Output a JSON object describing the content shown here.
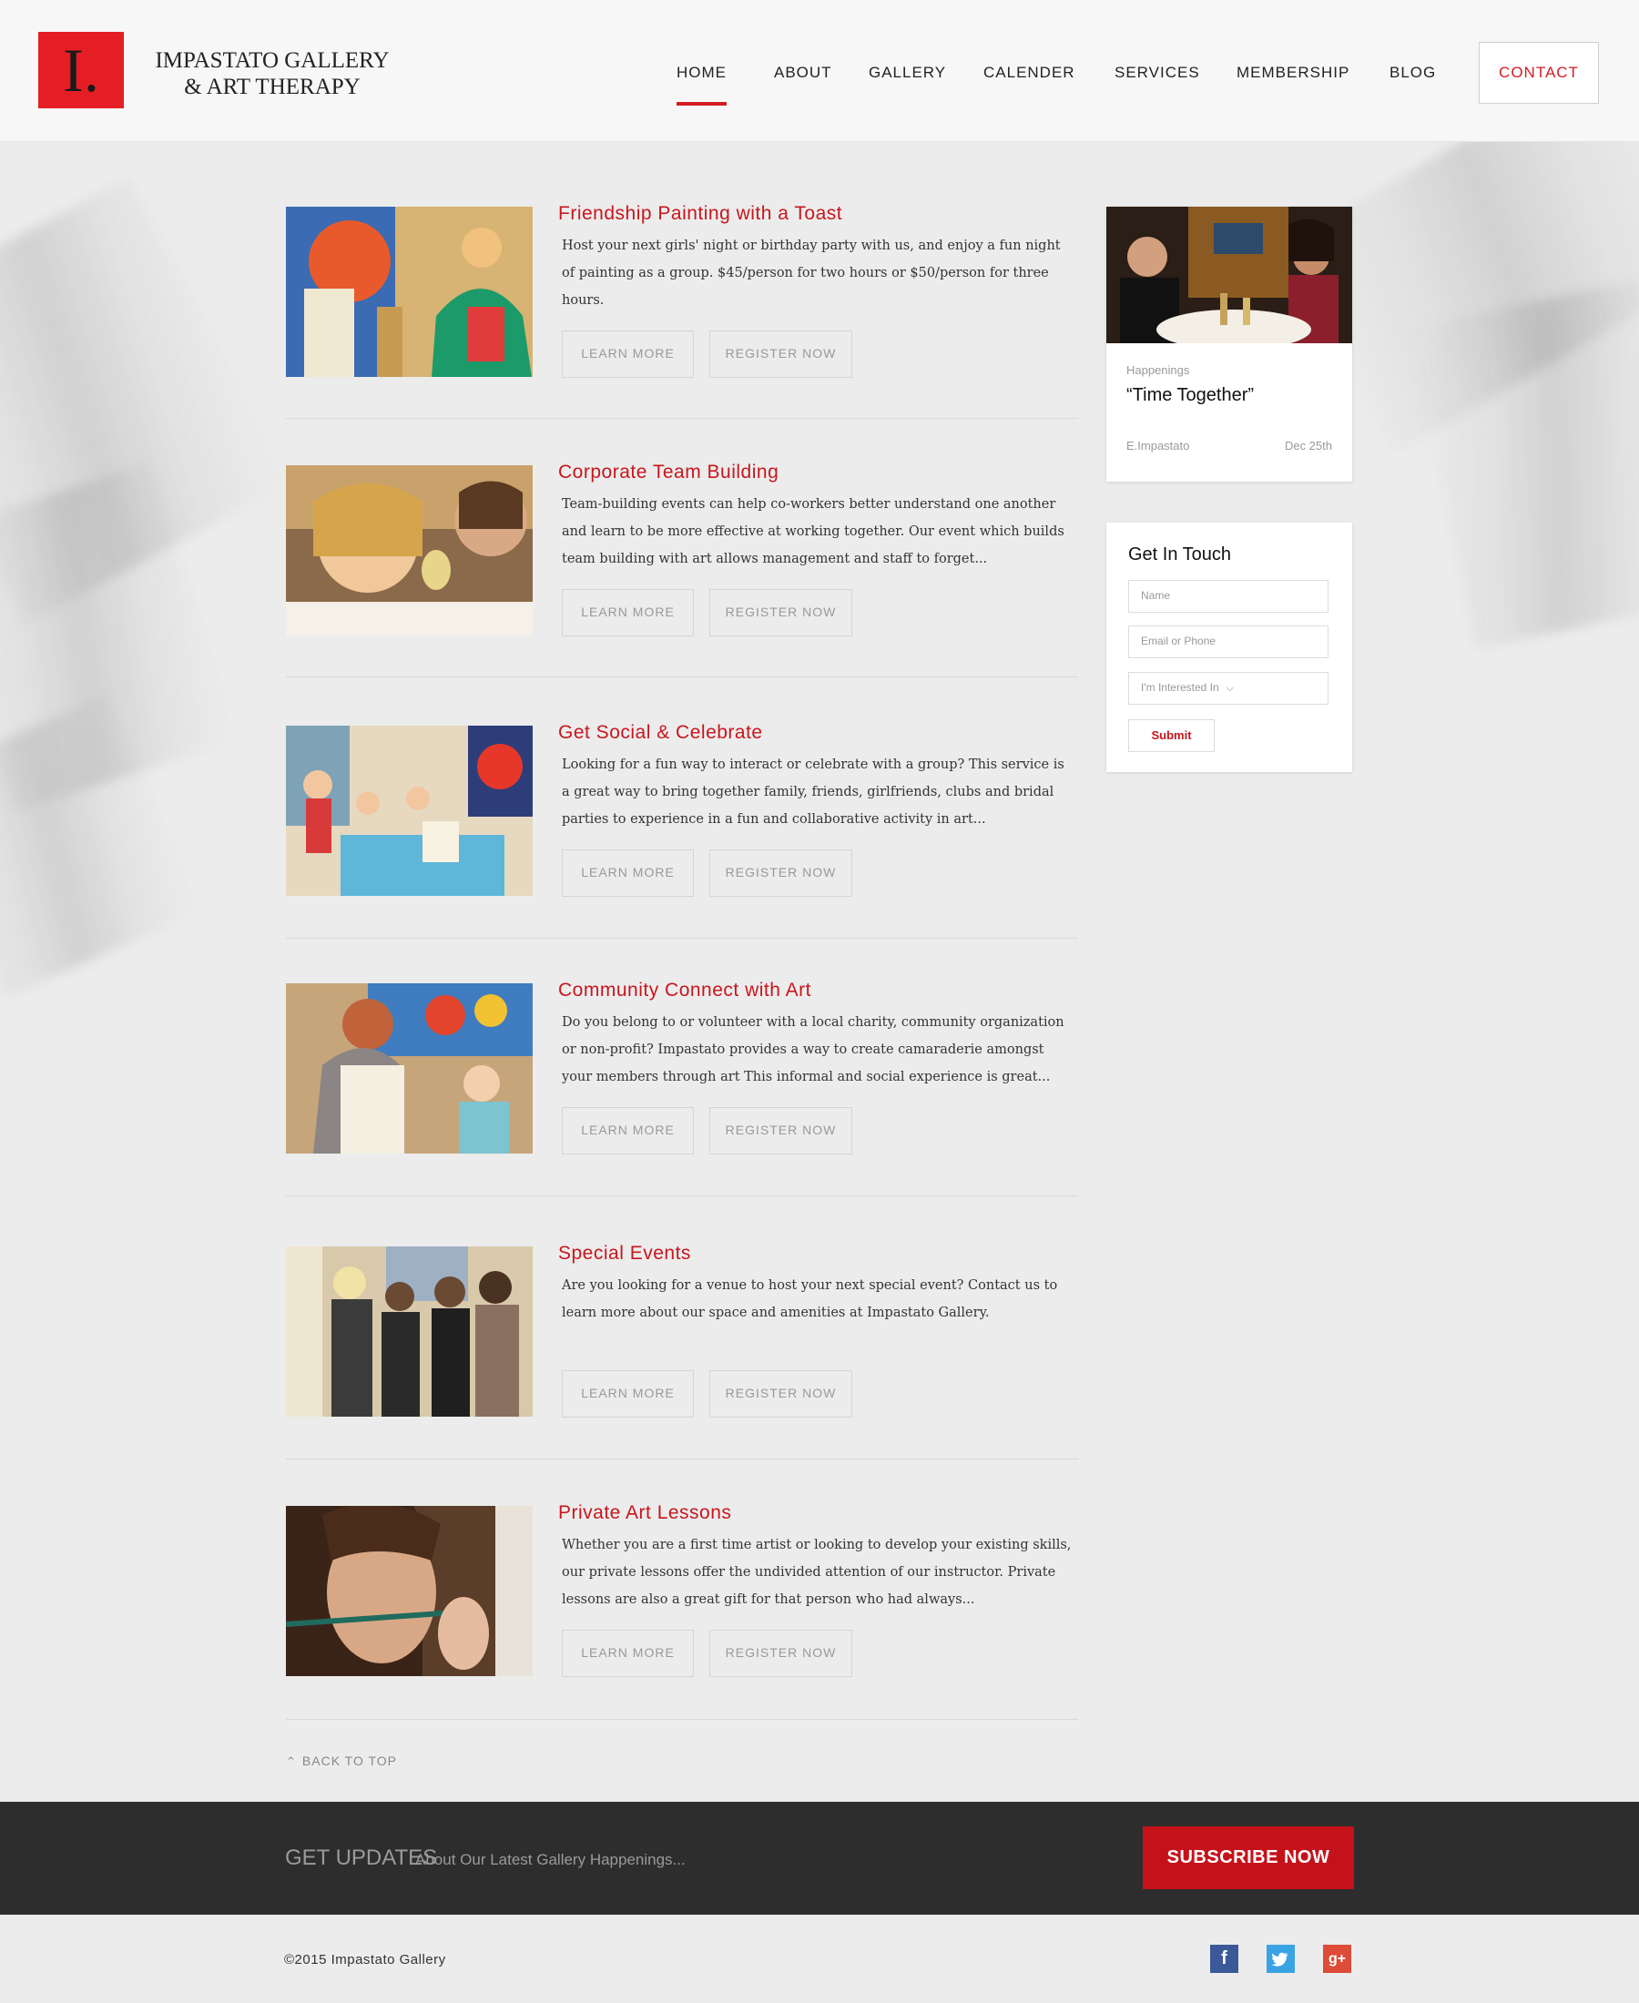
{
  "brand": {
    "logo_letter": "I.",
    "name_line1": "IMPASTATO GALLERY",
    "name_line2": "& ART THERAPY",
    "accent": "#d11d24"
  },
  "nav": {
    "items": [
      "HOME",
      "ABOUT",
      "GALLERY",
      "CALENDER",
      "SERVICES",
      "MEMBERSHIP",
      "BLOG"
    ],
    "active": "HOME",
    "contact": "CONTACT"
  },
  "services": [
    {
      "title": "Friendship Painting with a Toast",
      "desc": "Host your next girls' night or birthday party with us, and enjoy a fun night of painting as a group. $45/person for two hours or $50/person for three hours.",
      "learn": "LEARN MORE",
      "register": "REGISTER NOW"
    },
    {
      "title": "Corporate Team Building",
      "desc": "Team-building events can help co-workers better understand one another and learn to be more effective at working together. Our event which builds team building with art allows management and staff to forget...",
      "learn": "LEARN MORE",
      "register": "REGISTER NOW"
    },
    {
      "title": "Get Social & Celebrate",
      "desc": "Looking for a fun way to interact or celebrate with a group? This service is a great way to bring together family, friends, girlfriends, clubs and bridal parties to experience in a fun and collaborative activity in art...",
      "learn": "LEARN MORE",
      "register": "REGISTER NOW"
    },
    {
      "title": "Community Connect with Art",
      "desc": "Do you belong to or volunteer with a local charity, community organization or non-profit? Impastato provides a way to create camaraderie amongst your members through art This informal and social experience is great...",
      "learn": "LEARN MORE",
      "register": "REGISTER NOW"
    },
    {
      "title": "Special Events",
      "desc": "Are you looking for a venue to host your next special event? Contact us to learn more about our space and amenities at Impastato Gallery.",
      "learn": "LEARN MORE",
      "register": "REGISTER NOW"
    },
    {
      "title": "Private Art Lessons",
      "desc": "Whether you are a first time artist or looking to develop your existing skills, our private lessons offer the undivided attention of our instructor. Private lessons are also a great gift for that person who had always...",
      "learn": "LEARN MORE",
      "register": "REGISTER NOW"
    }
  ],
  "happenings": {
    "kicker": "Happenings",
    "title": "“Time Together”",
    "author": "E.Impastato",
    "date": "Dec 25th"
  },
  "contact_form": {
    "title": "Get In Touch",
    "name_placeholder": "Name",
    "email_placeholder": "Email or Phone",
    "interest_placeholder": "I'm Interested In",
    "submit": "Submit"
  },
  "back_to_top": "BACK TO TOP",
  "footer": {
    "updates_big": "GET UPDATES",
    "updates_small": "About Our Latest Gallery Happenings...",
    "subscribe": "SUBSCRIBE NOW",
    "copyright": "©2015 Impastato Gallery",
    "social": [
      "facebook-icon",
      "twitter-icon",
      "google-plus-icon"
    ]
  }
}
